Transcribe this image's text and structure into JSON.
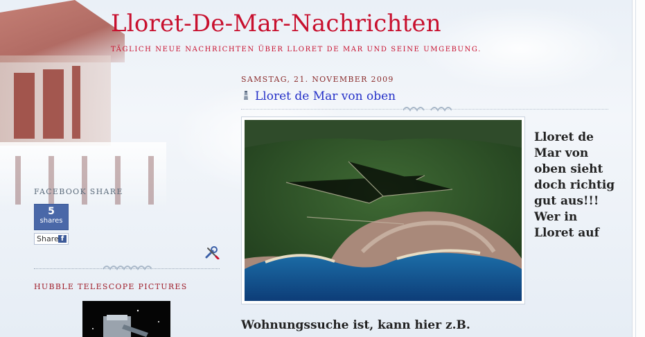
{
  "header": {
    "title": "Lloret-De-Mar-Nachrichten",
    "description": "TÄGLICH NEUE NACHRICHTEN ÜBER LLORET DE MAR UND SEINE UMGEBUNG."
  },
  "sidebar": {
    "facebook": {
      "heading": "FACEBOOK SHARE",
      "count": "5",
      "count_label": "shares",
      "share_label": "Share",
      "f_glyph": "f",
      "brand_color": "#3b5998"
    },
    "hubble": {
      "heading": "HUBBLE TELESCOPE PICTURES"
    }
  },
  "post": {
    "date": "SAMSTAG, 21. NOVEMBER 2009",
    "title": "Lloret de Mar von oben",
    "side_text": "Lloret de Mar von oben sieht doch richtig gut aus!!! Wer in Lloret auf",
    "body_text": "Wohnungssuche ist, kann hier z.B."
  },
  "colors": {
    "accent_red": "#c8102e",
    "link_blue": "#2430c8"
  },
  "icons": {
    "post_title_icon": "lighthouse-icon",
    "tools_icon": "wrench-screwdriver-icon"
  }
}
